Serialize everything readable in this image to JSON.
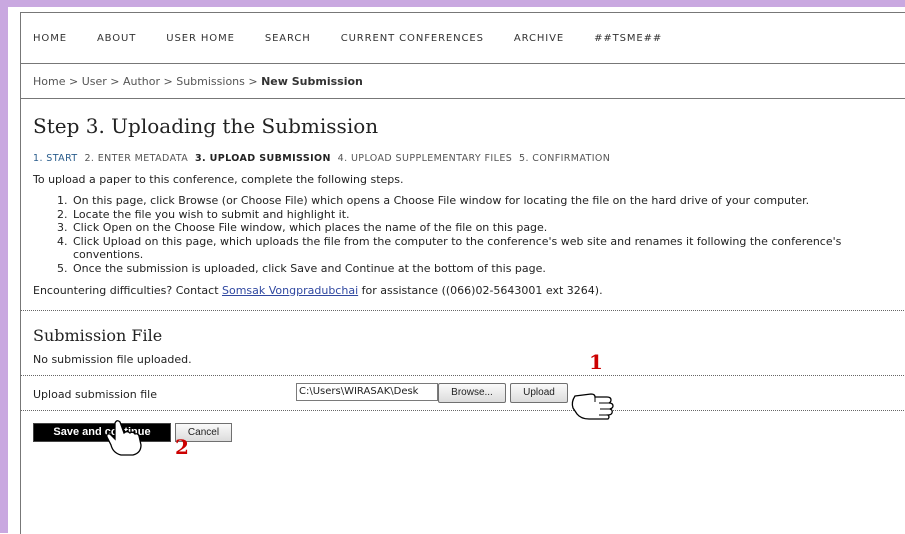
{
  "nav": {
    "items": [
      "HOME",
      "ABOUT",
      "USER HOME",
      "SEARCH",
      "CURRENT CONFERENCES",
      "ARCHIVE",
      "##TSME##"
    ]
  },
  "breadcrumb": {
    "path": "Home > User > Author > Submissions > ",
    "current": "New Submission"
  },
  "page": {
    "title": "Step 3. Uploading the Submission",
    "steps": {
      "s1": "1. START",
      "s2": "2. ENTER METADATA",
      "s3": "3. UPLOAD SUBMISSION",
      "s4": "4. UPLOAD SUPPLEMENTARY FILES",
      "s5": "5. CONFIRMATION"
    },
    "intro": "To upload a paper to this conference, complete the following steps.",
    "instructions": [
      "On this page, click Browse (or Choose File) which opens a Choose File window for locating the file on the hard drive of your computer.",
      "Locate the file you wish to submit and highlight it.",
      "Click Open on the Choose File window, which places the name of the file on this page.",
      "Click Upload on this page, which uploads the file from the computer to the conference's web site and renames it following the conference's conventions.",
      "Once the submission is uploaded, click Save and Continue at the bottom of this page."
    ],
    "contact": {
      "prefix": "Encountering difficulties? Contact ",
      "name": "Somsak Vongpradubchai",
      "suffix": " for assistance ((066)02-5643001 ext 3264)."
    }
  },
  "submission": {
    "heading": "Submission File",
    "status": "No submission file uploaded.",
    "upload_label": "Upload submission file",
    "file_value": "C:\\Users\\WIRASAK\\Desk",
    "browse_label": "Browse...",
    "upload_button": "Upload"
  },
  "actions": {
    "save_label": "Save and continue",
    "cancel_label": "Cancel"
  },
  "annotations": {
    "marker1": "1",
    "marker2": "2"
  },
  "colors": {
    "accent_band": "#c9a8e0",
    "link": "#3048a0",
    "current_step": "#2a5d8c",
    "marker": "#cc0000"
  }
}
